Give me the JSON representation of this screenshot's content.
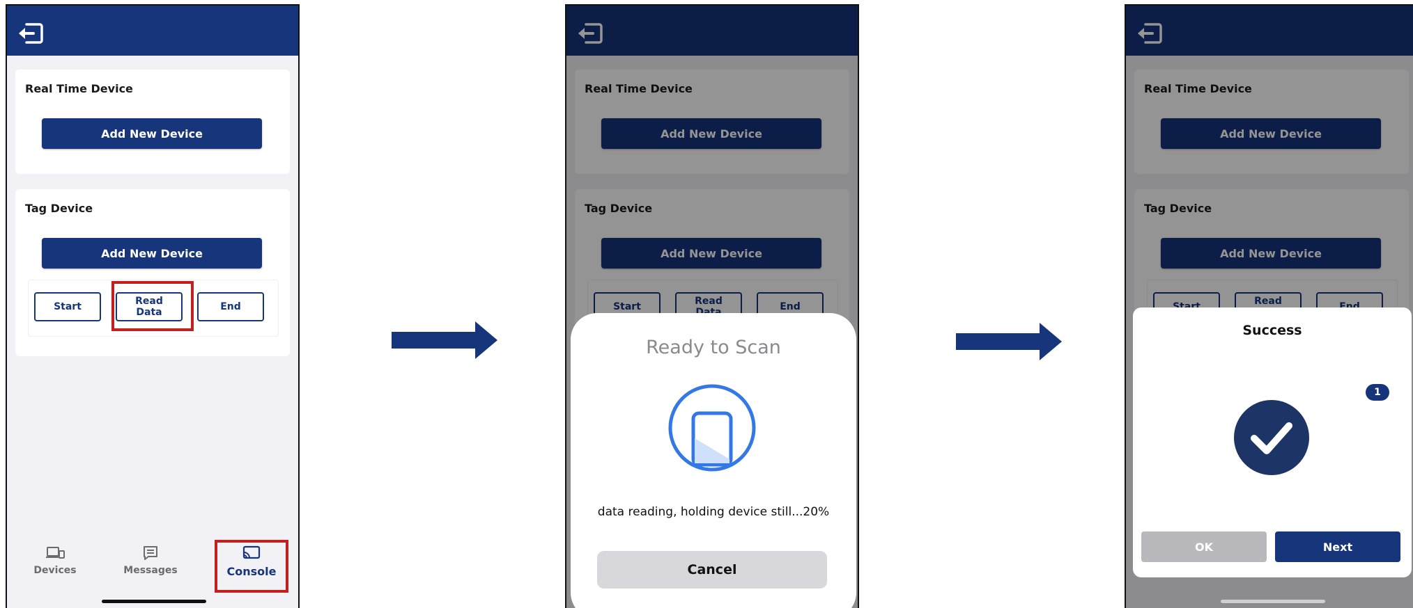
{
  "screens": [
    {
      "sections": {
        "real_time": {
          "title": "Real Time Device",
          "add_button": "Add New Device"
        },
        "tag": {
          "title": "Tag Device",
          "add_button": "Add New Device",
          "actions": {
            "start": "Start",
            "read": "Read Data",
            "end": "End"
          }
        }
      },
      "tabbar": {
        "devices": "Devices",
        "messages": "Messages",
        "console": "Console"
      },
      "highlight_color": "#c31f1f"
    },
    {
      "sections": {
        "real_time": {
          "title": "Real Time Device",
          "add_button": "Add New Device"
        },
        "tag": {
          "title": "Tag Device",
          "add_button": "Add New Device",
          "actions": {
            "start": "Start",
            "read": "Read Data",
            "end": "End"
          }
        }
      },
      "scan_sheet": {
        "title": "Ready to Scan",
        "status": "data reading, holding device still...20%",
        "progress_percent": 20,
        "cancel": "Cancel"
      }
    },
    {
      "sections": {
        "real_time": {
          "title": "Real Time Device",
          "add_button": "Add New Device"
        },
        "tag": {
          "title": "Tag Device",
          "add_button": "Add New Device",
          "actions": {
            "start": "Start",
            "read": "Read Data",
            "end": "End"
          }
        }
      },
      "success_dialog": {
        "title": "Success",
        "badge": "1",
        "ok": "OK",
        "next": "Next"
      }
    }
  ],
  "colors": {
    "brand": "#16357a",
    "background": "#f2f2f6",
    "highlight": "#c31f1f"
  },
  "icons": [
    "logout-icon",
    "devices-icon",
    "messages-icon",
    "console-icon",
    "phone-scan-icon",
    "checkmark-icon",
    "right-arrow"
  ]
}
